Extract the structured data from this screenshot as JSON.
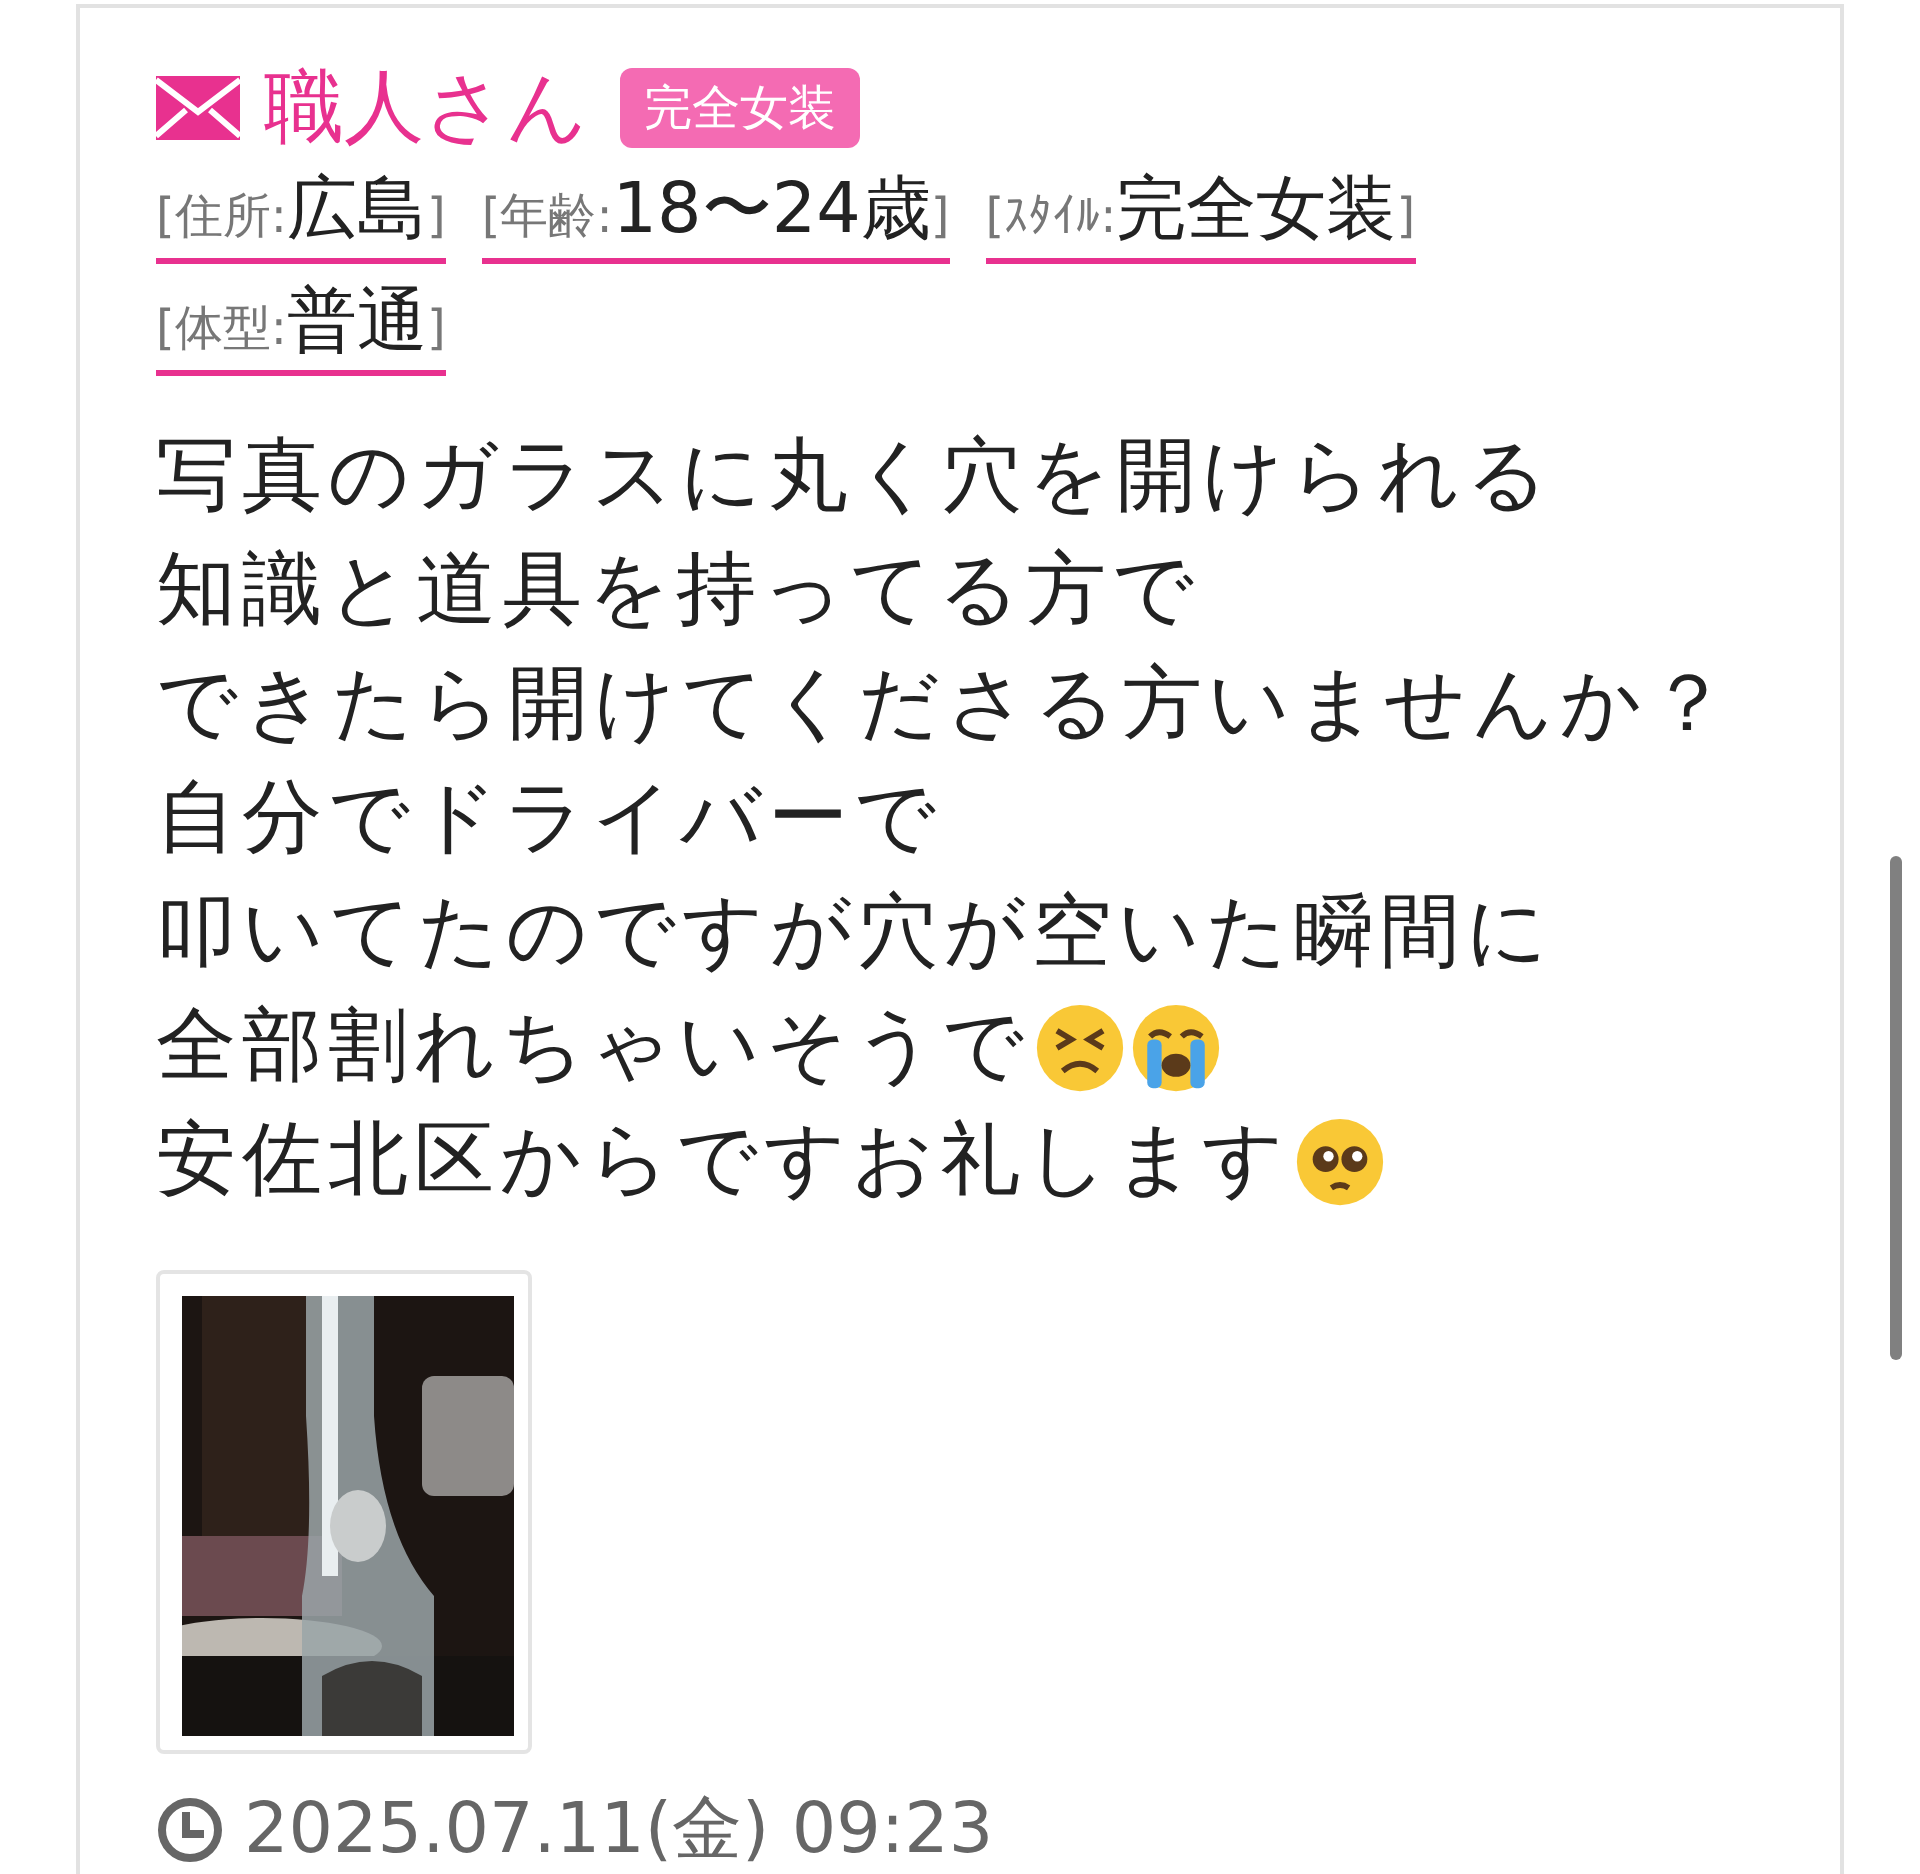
{
  "post": {
    "author": "職人さん",
    "badge": "完全女装",
    "profile": [
      {
        "label": "[住所:",
        "value": "広島",
        "close": "]"
      },
      {
        "label": "[年齢:",
        "value": "18〜24歳",
        "close": "]"
      },
      {
        "label": "[ｽﾀｲﾙ:",
        "value": "完全女装",
        "close": "]"
      },
      {
        "label": "[体型:",
        "value": "普通",
        "close": "]"
      }
    ],
    "body": [
      {
        "text": "写真のガラスに丸く穴を開けられる"
      },
      {
        "text": "知識と道具を持ってる方で"
      },
      {
        "text": "できたら開けてくださる方いませんか？"
      },
      {
        "text": "自分でドライバーで"
      },
      {
        "text": "叩いてたのですが穴が空いた瞬間に"
      },
      {
        "text": "全部割れちゃいそうで",
        "faces": [
          {
            "kind": "persevering"
          },
          {
            "kind": "crying"
          }
        ]
      },
      {
        "text": "安佐北区からですお礼します",
        "faces": [
          {
            "kind": "pleading"
          }
        ]
      }
    ],
    "posted_at": "2025.07.11(金) 09:23"
  }
}
